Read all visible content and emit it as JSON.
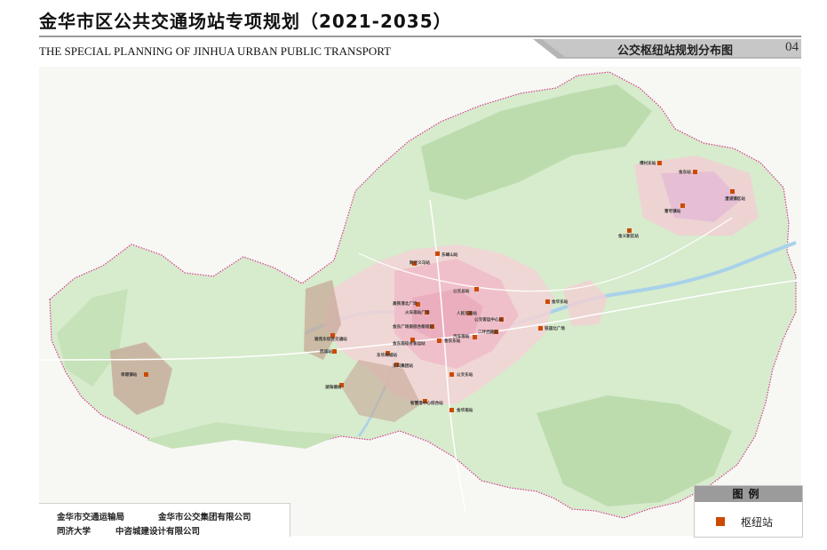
{
  "header": {
    "title": "金华市区公共交通场站专项规划（2021-2035）",
    "subtitle": "THE SPECIAL PLANNING OF JINHUA URBAN PUBLIC TRANSPORT",
    "sheet_title": "公交枢纽站规划分布图",
    "sheet_number": "04"
  },
  "credits": {
    "line1_a": "金华市交通运输局",
    "line1_b": "金华市公交集团有限公司",
    "line2_a": "同济大学",
    "line2_b": "中咨城建设计有限公司"
  },
  "legend": {
    "title": "图例",
    "items": [
      {
        "label": "枢纽站",
        "color": "#cc4a00"
      }
    ]
  },
  "colors": {
    "hub": "#cc4a00",
    "green_land": "#d7ebcd",
    "forest": "#b9dbab",
    "water": "#a9d2ea",
    "boundary": "#d63c8c",
    "band_gray": "#b5b5b5"
  },
  "stations": [
    {
      "label": "东峰山站"
    },
    {
      "label": "新世义乌站"
    },
    {
      "label": "公交总站"
    },
    {
      "label": "高铁港北广场"
    },
    {
      "label": "火车南站广场"
    },
    {
      "label": "人民东路站"
    },
    {
      "label": "金华东站"
    },
    {
      "label": "公交客运中心站"
    },
    {
      "label": "金东广场南综合枢纽站"
    },
    {
      "label": "金东南综合客运站"
    },
    {
      "label": "汽车南站"
    },
    {
      "label": "二环西路站"
    },
    {
      "label": "铁道北广场"
    },
    {
      "label": "雅苑东综合交通站"
    },
    {
      "label": "西城站"
    },
    {
      "label": "金东东站"
    },
    {
      "label": "东华商城站"
    },
    {
      "label": "东科集团站"
    },
    {
      "label": "公交东站"
    },
    {
      "label": "湖海塘站"
    },
    {
      "label": "智慧港中心综合站"
    },
    {
      "label": "金华南站"
    },
    {
      "label": "孝顺镇站"
    },
    {
      "label": "傅村东站"
    },
    {
      "label": "金东站"
    },
    {
      "label": "澧浦镇区站"
    },
    {
      "label": "曹宅镇站"
    },
    {
      "label": "金义新区站"
    }
  ]
}
